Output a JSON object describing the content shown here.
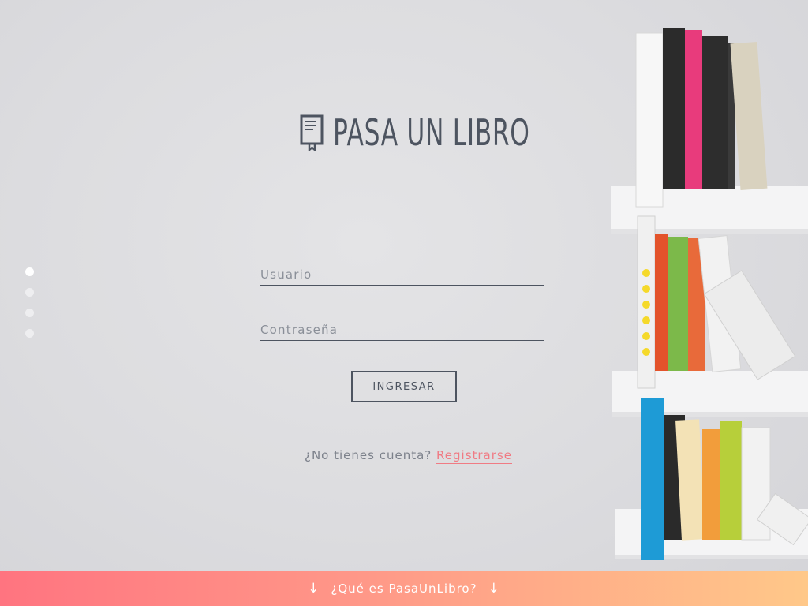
{
  "brand": {
    "name": "PASA UN LIBRO",
    "icon": "book-icon",
    "color": "#4d5460"
  },
  "slider": {
    "dots": 4,
    "active_index": 0
  },
  "login": {
    "username_placeholder": "Usuario",
    "password_placeholder": "Contraseña",
    "submit_label": "INGRESAR"
  },
  "signup": {
    "prompt": "¿No tienes cuenta?",
    "link_label": "Registrarse",
    "link_color": "#f07b84"
  },
  "footer": {
    "label": "¿Qué es PasaUnLibro?",
    "arrow_icon": "arrow-down-icon",
    "gradient_start": "#ff7480",
    "gradient_end": "#ffc889"
  }
}
